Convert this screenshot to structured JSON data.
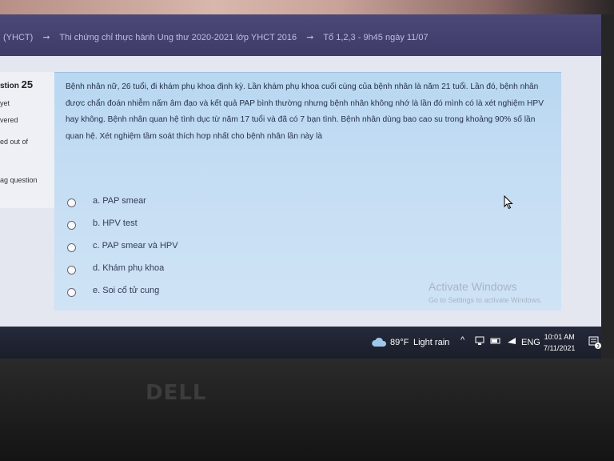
{
  "breadcrumb": {
    "course": "(YHCT)",
    "exam": "Thi chứng chỉ thực hành Ung thư 2020-2021 lớp YHCT 2016",
    "session": "Tổ 1,2,3 - 9h45 ngày 11/07"
  },
  "info": {
    "question_label": "stion",
    "question_number": "25",
    "line1": "yet",
    "line2": "vered",
    "line3": "ed out of",
    "flag": "ag question"
  },
  "question": {
    "text": "Bệnh nhân nữ, 26 tuổi, đi khám phụ khoa định kỳ. Lần khám phụ khoa cuối cùng của bệnh nhân là năm 21 tuổi. Lần đó, bệnh nhân được chẩn đoán nhiễm nấm âm đạo và kết quả PAP bình thường nhưng bệnh nhân không nhớ là lần đó mình có là xét nghiệm HPV hay không. Bệnh nhân quan hệ tình dục từ năm 17 tuổi và đã có 7 bạn tình. Bệnh nhân dùng bao cao su trong khoảng 90% số lần quan hệ. Xét nghiệm tầm soát thích hơp nhất cho bệnh nhân lần này là",
    "answers": [
      "a. PAP smear",
      "b. HPV test",
      "c. PAP smear và HPV",
      "d. Khám phụ khoa",
      "e. Soi cổ tử cung"
    ]
  },
  "watermark": {
    "title": "Activate Windows",
    "subtitle": "Go to Settings to activate Windows."
  },
  "taskbar": {
    "temperature": "89°F",
    "weather": "Light rain",
    "language": "ENG",
    "time": "10:01 AM",
    "date": "7/11/2021",
    "notification_count": "3"
  },
  "laptop": {
    "brand": "DELL"
  },
  "icons": [
    "arrow-icon",
    "radio-icon",
    "cursor-icon",
    "cloud-icon",
    "chevron-up-icon",
    "network-icon",
    "volume-icon",
    "notification-icon"
  ]
}
